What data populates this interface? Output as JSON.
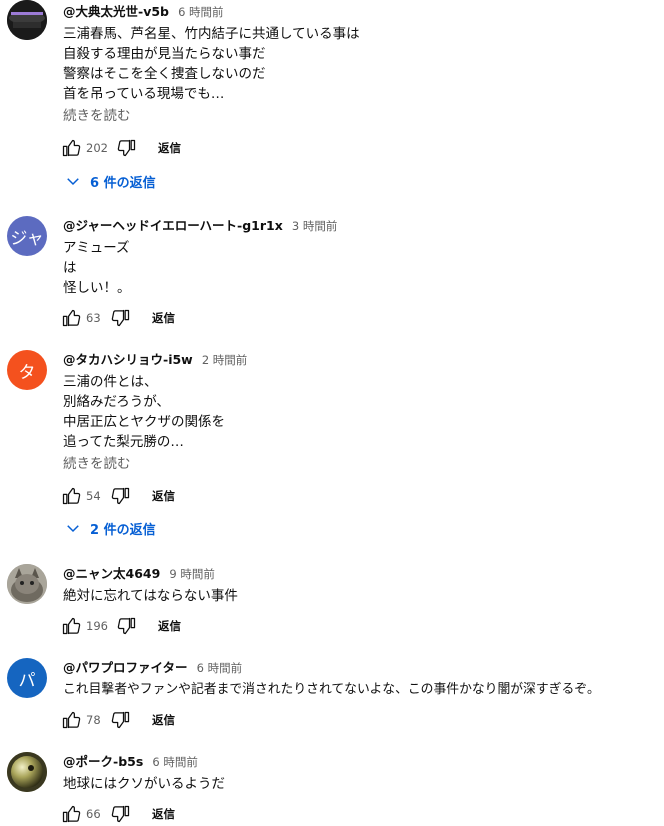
{
  "comments": [
    {
      "author": "@大典太光世-v5b",
      "time": "6 時間前",
      "lines": [
        "三浦春馬、芦名星、竹内結子に共通している事は",
        "自殺する理由が見当たらない事だ",
        "警察はそこを全く捜査しないのだ",
        "首を吊っている現場でも…"
      ],
      "more": "続きを読む",
      "likes": "202",
      "reply": "返信",
      "replies": "6 件の返信",
      "avatar_letter": "",
      "avatar_color": "#1a1a1a"
    },
    {
      "author": "@ジャーヘッドイエローハート-g1r1x",
      "time": "3 時間前",
      "lines": [
        "アミューズ",
        "は",
        "怪しい！。"
      ],
      "likes": "63",
      "reply": "返信",
      "avatar_letter": "ジャ",
      "avatar_color": "#5c6bc0"
    },
    {
      "author": "@タカハシリョウ-i5w",
      "time": "2 時間前",
      "lines": [
        "三浦の件とは、",
        "別絡みだろうが、",
        "中居正広とヤクザの関係を",
        "追ってた梨元勝の…"
      ],
      "more": "続きを読む",
      "likes": "54",
      "reply": "返信",
      "replies": "2 件の返信",
      "avatar_letter": "タ",
      "avatar_color": "#f4511e"
    },
    {
      "author": "@ニャン太4649",
      "time": "9 時間前",
      "lines": [
        "絶対に忘れてはならない事件"
      ],
      "likes": "196",
      "reply": "返信",
      "avatar_letter": "",
      "avatar_color": "#8d8a80"
    },
    {
      "author": "@パワプロファイター",
      "time": "6 時間前",
      "lines": [
        "これ目撃者やファンや記者まで消されたりされてないよな、この事件かなり闇が深すぎるぞ。"
      ],
      "likes": "78",
      "reply": "返信",
      "avatar_letter": "パ",
      "avatar_color": "#1565c0"
    },
    {
      "author": "@ポーク-b5s",
      "time": "6 時間前",
      "lines": [
        "地球にはクソがいるようだ"
      ],
      "likes": "66",
      "reply": "返信",
      "avatar_letter": "",
      "avatar_color": "#6b6a3a"
    }
  ],
  "icons": {
    "like": "thumb-up-icon",
    "dislike": "thumb-down-icon",
    "expand": "chevron-down-icon"
  },
  "colors": {
    "link_blue": "#065fd4",
    "secondary_text": "#606060"
  }
}
